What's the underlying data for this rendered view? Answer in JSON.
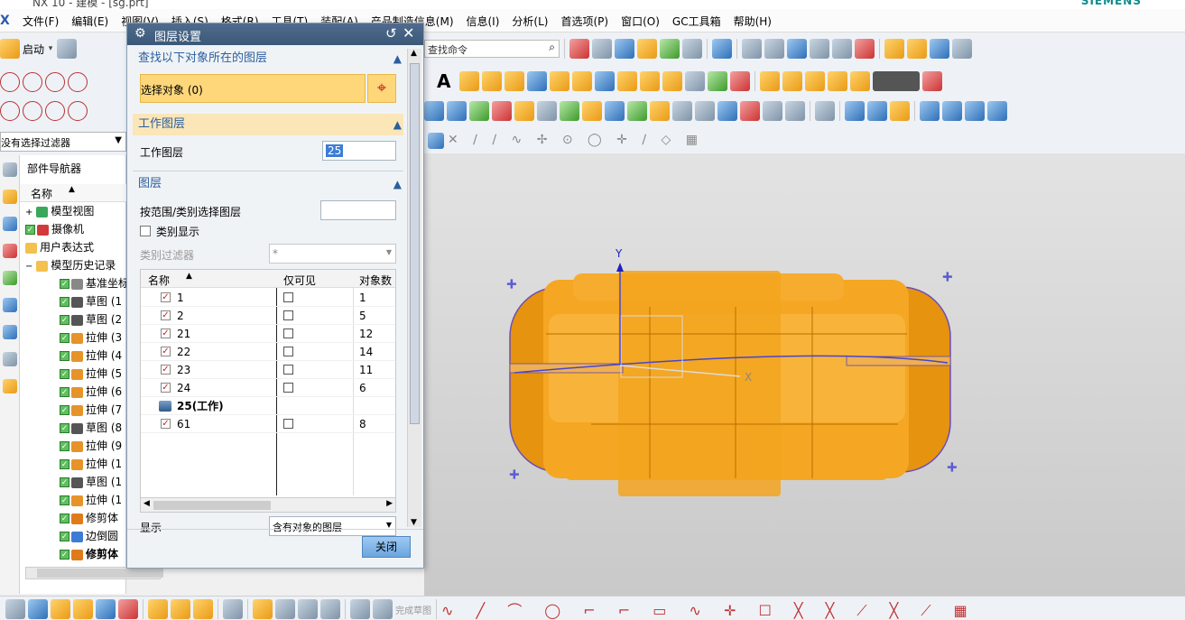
{
  "app": {
    "title_fragment": "NX 10 - 建模 - [sg.prt]",
    "brand": "SIEMENS"
  },
  "menu": [
    "文件(F)",
    "编辑(E)",
    "视图(V)",
    "插入(S)",
    "格式(R)",
    "工具(T)",
    "装配(A)",
    "产品制造信息(M)",
    "信息(I)",
    "分析(L)",
    "首选项(P)",
    "窗口(O)",
    "GC工具箱",
    "帮助(H)"
  ],
  "toolbar": {
    "start_label": "启动",
    "search_placeholder": "查找命令",
    "filter_value": "没有选择过滤器",
    "finish_sketch": "完成草图"
  },
  "nav": {
    "title": "部件导航器",
    "col_name": "名称",
    "items": [
      {
        "label": "模型视图",
        "type": "view"
      },
      {
        "label": "摄像机",
        "type": "camera"
      },
      {
        "label": "用户表达式",
        "type": "folder"
      },
      {
        "label": "模型历史记录",
        "type": "folder"
      },
      {
        "label": "基准坐标",
        "type": "datum"
      },
      {
        "label": "草图 (1",
        "type": "sketch"
      },
      {
        "label": "草图 (2",
        "type": "sketch"
      },
      {
        "label": "拉伸 (3",
        "type": "extrude"
      },
      {
        "label": "拉伸 (4",
        "type": "extrude"
      },
      {
        "label": "拉伸 (5",
        "type": "extrude"
      },
      {
        "label": "拉伸 (6",
        "type": "extrude"
      },
      {
        "label": "拉伸 (7",
        "type": "extrude"
      },
      {
        "label": "草图 (8",
        "type": "sketch"
      },
      {
        "label": "拉伸 (9",
        "type": "extrude"
      },
      {
        "label": "拉伸 (1",
        "type": "extrude"
      },
      {
        "label": "草图 (1",
        "type": "sketch"
      },
      {
        "label": "拉伸 (1",
        "type": "extrude"
      },
      {
        "label": "修剪体",
        "type": "trim"
      },
      {
        "label": "边倒圆",
        "type": "blend"
      },
      {
        "label": "修剪体",
        "type": "trim"
      }
    ]
  },
  "dialog": {
    "title": "图层设置",
    "sec_find": "查找以下对象所在的图层",
    "select_object": "选择对象 (0)",
    "sec_work": "工作图层",
    "work_layer_label": "工作图层",
    "work_layer_value": "25",
    "sec_layers": "图层",
    "range_label": "按范围/类别选择图层",
    "category_display": "类别显示",
    "category_filter": "类别过滤器",
    "category_filter_value": "*",
    "table_headers": [
      "名称",
      "仅可见",
      "对象数"
    ],
    "rows": [
      {
        "name": "1",
        "count": "1",
        "work": false
      },
      {
        "name": "2",
        "count": "5",
        "work": false
      },
      {
        "name": "21",
        "count": "12",
        "work": false
      },
      {
        "name": "22",
        "count": "14",
        "work": false
      },
      {
        "name": "23",
        "count": "11",
        "work": false
      },
      {
        "name": "24",
        "count": "6",
        "work": false
      },
      {
        "name": "25(工作)",
        "count": "",
        "work": true
      },
      {
        "name": "61",
        "count": "8",
        "work": false
      }
    ],
    "show_label": "显示",
    "show_value": "含有对象的图层",
    "close_label": "关闭"
  },
  "viewport": {
    "axis_x": "X",
    "axis_y": "Y",
    "body_color": "#f5a623"
  }
}
